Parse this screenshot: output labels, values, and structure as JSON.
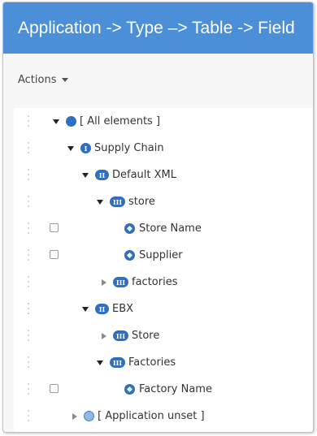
{
  "title": "Application -> Type –> Table -> Field",
  "actions_label": "Actions",
  "tree": [
    {
      "label": "[ All elements ]",
      "icon": "dot",
      "toggle": "open",
      "checkbox": false
    },
    {
      "label": "Supply Chain",
      "icon": "I",
      "toggle": "open",
      "checkbox": false
    },
    {
      "label": "Default XML",
      "icon": "II",
      "toggle": "open",
      "checkbox": false
    },
    {
      "label": "store",
      "icon": "III",
      "toggle": "open",
      "checkbox": false
    },
    {
      "label": "Store Name",
      "icon": "field",
      "toggle": "none",
      "checkbox": true
    },
    {
      "label": "Supplier",
      "icon": "field",
      "toggle": "none",
      "checkbox": true
    },
    {
      "label": "factories",
      "icon": "III",
      "toggle": "closed",
      "checkbox": false
    },
    {
      "label": "EBX",
      "icon": "II",
      "toggle": "open",
      "checkbox": false
    },
    {
      "label": "Store",
      "icon": "III",
      "toggle": "closed",
      "checkbox": false
    },
    {
      "label": "Factories",
      "icon": "III",
      "toggle": "open",
      "checkbox": false
    },
    {
      "label": "Factory Name",
      "icon": "field",
      "toggle": "none",
      "checkbox": true
    },
    {
      "label": "[ Application unset ]",
      "icon": "dot-light",
      "toggle": "closed",
      "checkbox": false
    }
  ]
}
